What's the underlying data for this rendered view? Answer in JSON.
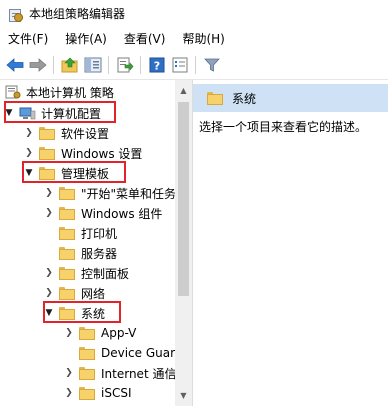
{
  "window": {
    "title": "本地组策略编辑器"
  },
  "menu": [
    {
      "label": "文件(F)"
    },
    {
      "label": "操作(A)"
    },
    {
      "label": "查看(V)"
    },
    {
      "label": "帮助(H)"
    }
  ],
  "toolbar": {
    "buttons": [
      "back-arrow-icon",
      "forward-arrow-icon",
      "up-folder-icon",
      "show-hide-tree-icon",
      "export-list-icon",
      "help-icon",
      "properties-icon",
      "filter-icon"
    ]
  },
  "tree": {
    "root": "本地计算机 策略",
    "items": [
      {
        "label": "计算机配置",
        "expanded": true,
        "highlighted": true
      },
      {
        "label": "软件设置",
        "expanded": false
      },
      {
        "label": "Windows 设置",
        "expanded": false
      },
      {
        "label": "管理模板",
        "expanded": true,
        "highlighted": true
      },
      {
        "label": "\"开始\"菜单和任务",
        "expanded": false
      },
      {
        "label": "Windows 组件",
        "expanded": false
      },
      {
        "label": "打印机",
        "expanded": false
      },
      {
        "label": "服务器",
        "expanded": false
      },
      {
        "label": "控制面板",
        "expanded": false
      },
      {
        "label": "网络",
        "expanded": false
      },
      {
        "label": "系统",
        "expanded": true,
        "highlighted": true
      },
      {
        "label": "App-V",
        "expanded": false
      },
      {
        "label": "Device Guard",
        "expanded": false
      },
      {
        "label": "Internet 通信",
        "expanded": false
      },
      {
        "label": "iSCSI",
        "expanded": false
      }
    ]
  },
  "right": {
    "header": "系统",
    "description": "选择一个项目来查看它的描述。"
  },
  "colors": {
    "highlight_box": "#e0242a",
    "header_bg": "#cfe2f5",
    "folder": "#f7d26b"
  }
}
